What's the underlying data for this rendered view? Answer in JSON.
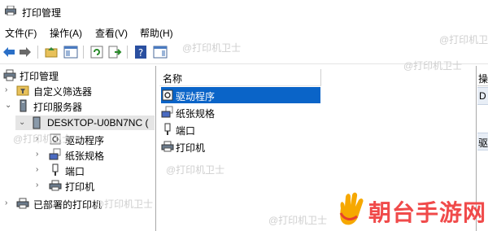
{
  "window": {
    "title": "打印管理"
  },
  "menu": [
    {
      "label": "文件(F)"
    },
    {
      "label": "操作(A)"
    },
    {
      "label": "查看(V)"
    },
    {
      "label": "帮助(H)"
    }
  ],
  "tree": {
    "root": "打印管理",
    "custom_filters": "自定义筛选器",
    "print_servers": "打印服务器",
    "server": "DESKTOP-U0BN7NC (",
    "drivers": "驱动程序",
    "forms": "纸张规格",
    "ports": "端口",
    "printers": "打印机",
    "deployed": "已部署的打印机"
  },
  "list": {
    "column_name": "名称",
    "items": [
      {
        "label": "驱动程序"
      },
      {
        "label": "纸张规格"
      },
      {
        "label": "端口"
      },
      {
        "label": "打印机"
      }
    ]
  },
  "actions": {
    "header": "操",
    "row1": "D",
    "row2": "驱"
  },
  "watermarks": [
    "@打印机卫士",
    "@打印机卫士",
    "@打印机卫士",
    "@打印机卫士",
    "@打印机卫士",
    "@打印机卫士",
    "@打印机卫士"
  ],
  "brand": {
    "text": "朝台手游网"
  }
}
